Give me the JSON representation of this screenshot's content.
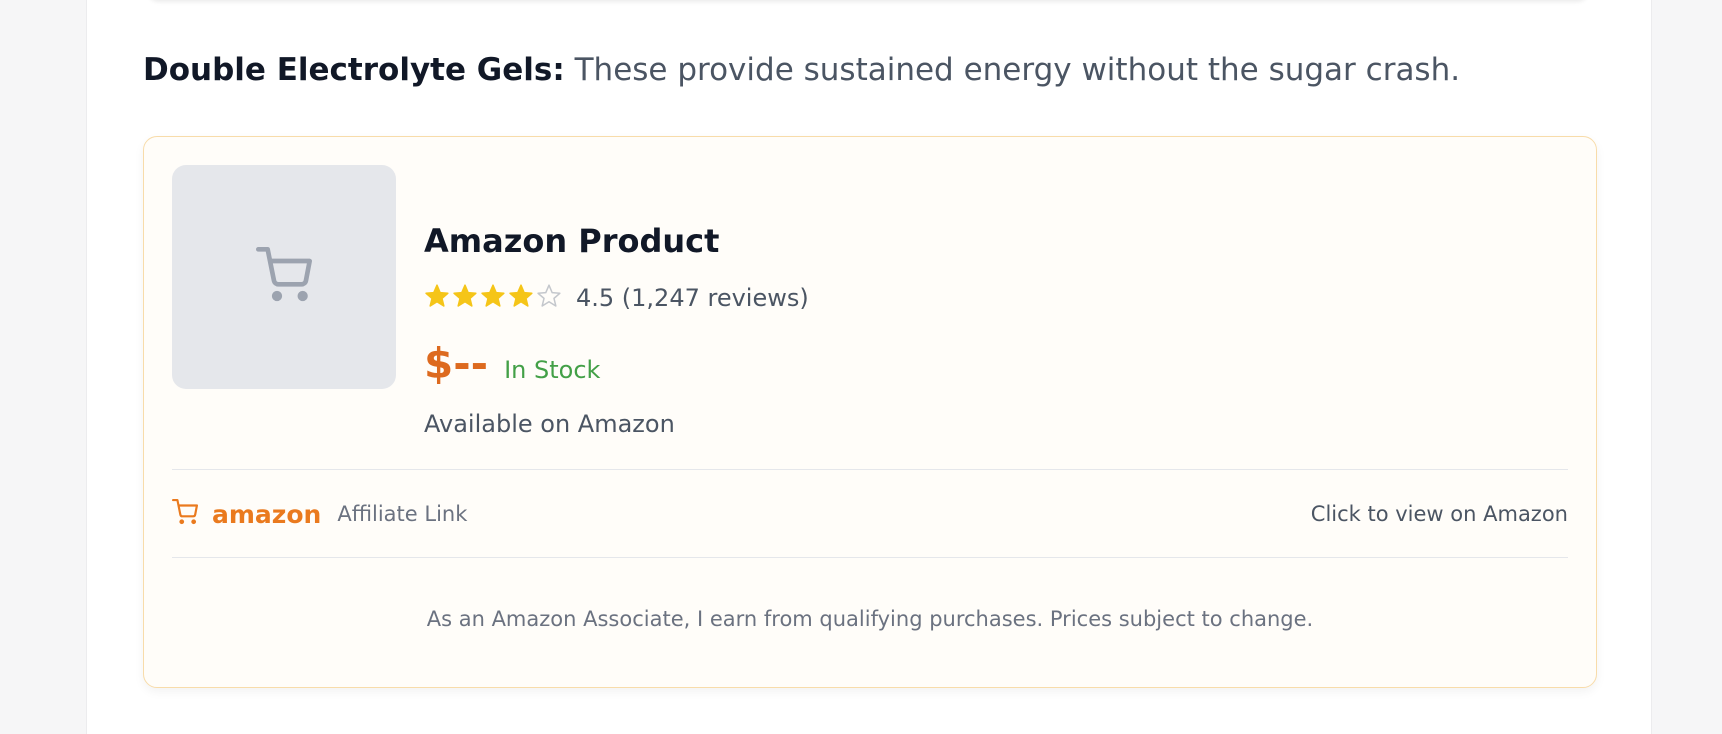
{
  "lead": {
    "label": "Double Electrolyte Gels:",
    "text": " These provide sustained energy without the sugar crash."
  },
  "product": {
    "image_icon": "shopping-cart-icon",
    "title": "Amazon Product",
    "rating": 4.5,
    "rating_text": "4.5 (1,247 reviews)",
    "price": "$--",
    "stock": "In Stock",
    "availability": "Available on Amazon"
  },
  "affiliate": {
    "brand_icon": "shopping-cart-icon",
    "brand": "amazon",
    "label": "Affiliate Link",
    "cta": "Click to view on Amazon"
  },
  "disclosure": "As an Amazon Associate, I earn from qualifying purchases. Prices subject to change.",
  "colors": {
    "accent": "#dd6a1f",
    "brand": "#ea7a1e",
    "stock": "#43a047",
    "star": "#f5c518",
    "card_border": "#f8dcaa"
  }
}
